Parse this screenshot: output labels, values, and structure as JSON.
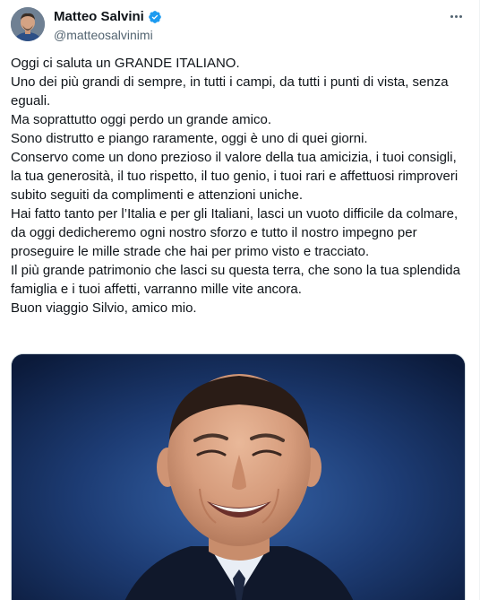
{
  "author": {
    "display_name": "Matteo Salvini",
    "handle": "@matteosalvinimi",
    "verified": true,
    "avatar_icon": "avatar-photo",
    "verified_color": "#1d9bf0"
  },
  "menu": {
    "icon": "more-horizontal-icon"
  },
  "tweet": {
    "paragraphs": [
      "Oggi ci saluta un GRANDE ITALIANO.",
      "Uno dei più grandi di sempre, in tutti i campi, da tutti i punti di vista, senza eguali.",
      "Ma soprattutto oggi perdo un grande amico.",
      "Sono distrutto e piango raramente, oggi è uno di quei giorni.",
      "Conservo come un dono prezioso il valore della tua amicizia, i tuoi consigli, la tua generosità, il tuo rispetto, il tuo genio, i tuoi rari e affettuosi rimproveri subito seguiti da complimenti e attenzioni uniche.",
      "Hai fatto tanto per l’Italia e per gli Italiani, lasci un vuoto difficile da colmare, da oggi dedicheremo ogni nostro sforzo e tutto il nostro impegno per proseguire le mille strade che hai per primo visto e tracciato.",
      "Il più grande patrimonio che lasci su questa terra, che sono la tua splendida famiglia e i tuoi affetti, varranno mille vite ancora.",
      "Buon viaggio Silvio, amico mio."
    ]
  },
  "media": {
    "type": "photo",
    "background_color": "#1c3769"
  }
}
